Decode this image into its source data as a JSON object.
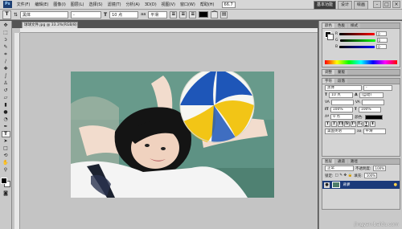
{
  "menubar": {
    "app_icon": "Ps",
    "items": [
      "文件(F)",
      "编辑(E)",
      "图像(I)",
      "图层(L)",
      "选择(S)",
      "滤镜(T)",
      "分析(A)",
      "3D(D)",
      "视图(V)",
      "窗口(W)",
      "帮助(H)"
    ],
    "zoom": "66.7",
    "workspaces": [
      "基本功能",
      "设计",
      "绘画"
    ],
    "window_controls": [
      "-",
      "□",
      "×"
    ]
  },
  "options_bar": {
    "tool_icon": "T",
    "font_family": "黑体",
    "font_style": "-",
    "font_size": "10 点",
    "antialias": "平滑"
  },
  "document": {
    "tab_title": "球球文件.jpg @ 33.3%(RGB/8) ×"
  },
  "panels": {
    "color": {
      "tabs": [
        "颜色",
        "色板",
        "样式"
      ],
      "sliders": [
        {
          "label": "R",
          "value": "0"
        },
        {
          "label": "G",
          "value": "0"
        },
        {
          "label": "B",
          "value": "0"
        }
      ]
    },
    "adjustments": {
      "tabs": [
        "调整",
        "蒙版"
      ]
    },
    "character": {
      "tabs": [
        "字符",
        "段落"
      ],
      "font_family": "黑体",
      "font_style": "-",
      "size": "10 点",
      "leading": "(自动)",
      "vertical_scale": "100%",
      "horizontal_scale": "100%",
      "baseline": "0 点",
      "color_label": "颜色:",
      "language": "美国英语",
      "antialias": "平滑",
      "format_buttons": [
        "T",
        "T",
        "TT",
        "Tr",
        "T¹",
        "T₁",
        "T",
        "Ŧ"
      ]
    },
    "layers": {
      "tabs": [
        "图层",
        "通道",
        "路径"
      ],
      "blend_mode": "正常",
      "opacity_label": "不透明度:",
      "opacity": "100%",
      "lock_label": "锁定:",
      "fill_label": "填充:",
      "fill": "100%",
      "layer_name": "背景"
    }
  },
  "watermark": "jingyan.baidu.com",
  "colors": {
    "accent": "#1b3a7a",
    "canvas": "#c4c4c4"
  }
}
